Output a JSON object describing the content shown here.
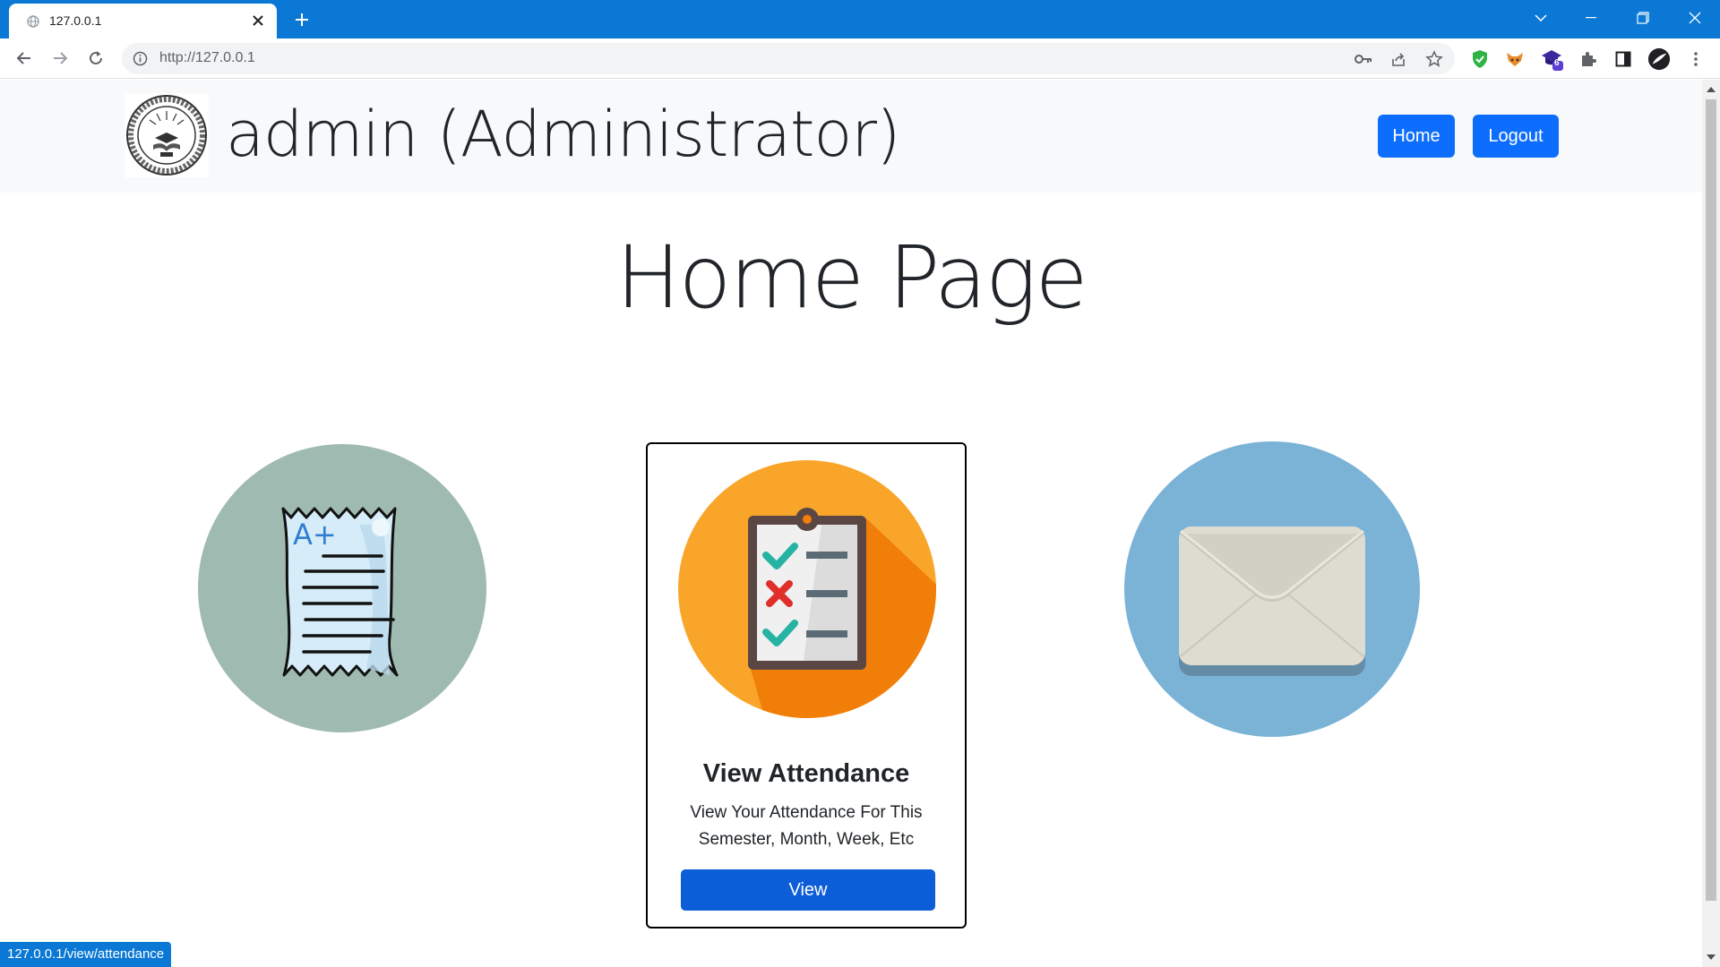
{
  "browser": {
    "tab_title": "127.0.0.1",
    "url": "http://127.0.0.1",
    "extension_badge": "6",
    "status_url": "127.0.0.1/view/attendance"
  },
  "navbar": {
    "brand": "admin (Administrator)",
    "home_label": "Home",
    "logout_label": "Logout"
  },
  "page": {
    "title": "Home Page"
  },
  "features": [
    {
      "icon": "grade-receipt-icon"
    },
    {
      "icon": "attendance-clipboard-icon",
      "title": "View Attendance",
      "description": "View Your Attendance For This Semester, Month, Week, Etc",
      "button_label": "View"
    },
    {
      "icon": "envelope-icon"
    }
  ],
  "colors": {
    "browser_accent": "#0a78d4",
    "primary_button": "#0d6efd",
    "navbar_bg": "#f8f9fa"
  }
}
